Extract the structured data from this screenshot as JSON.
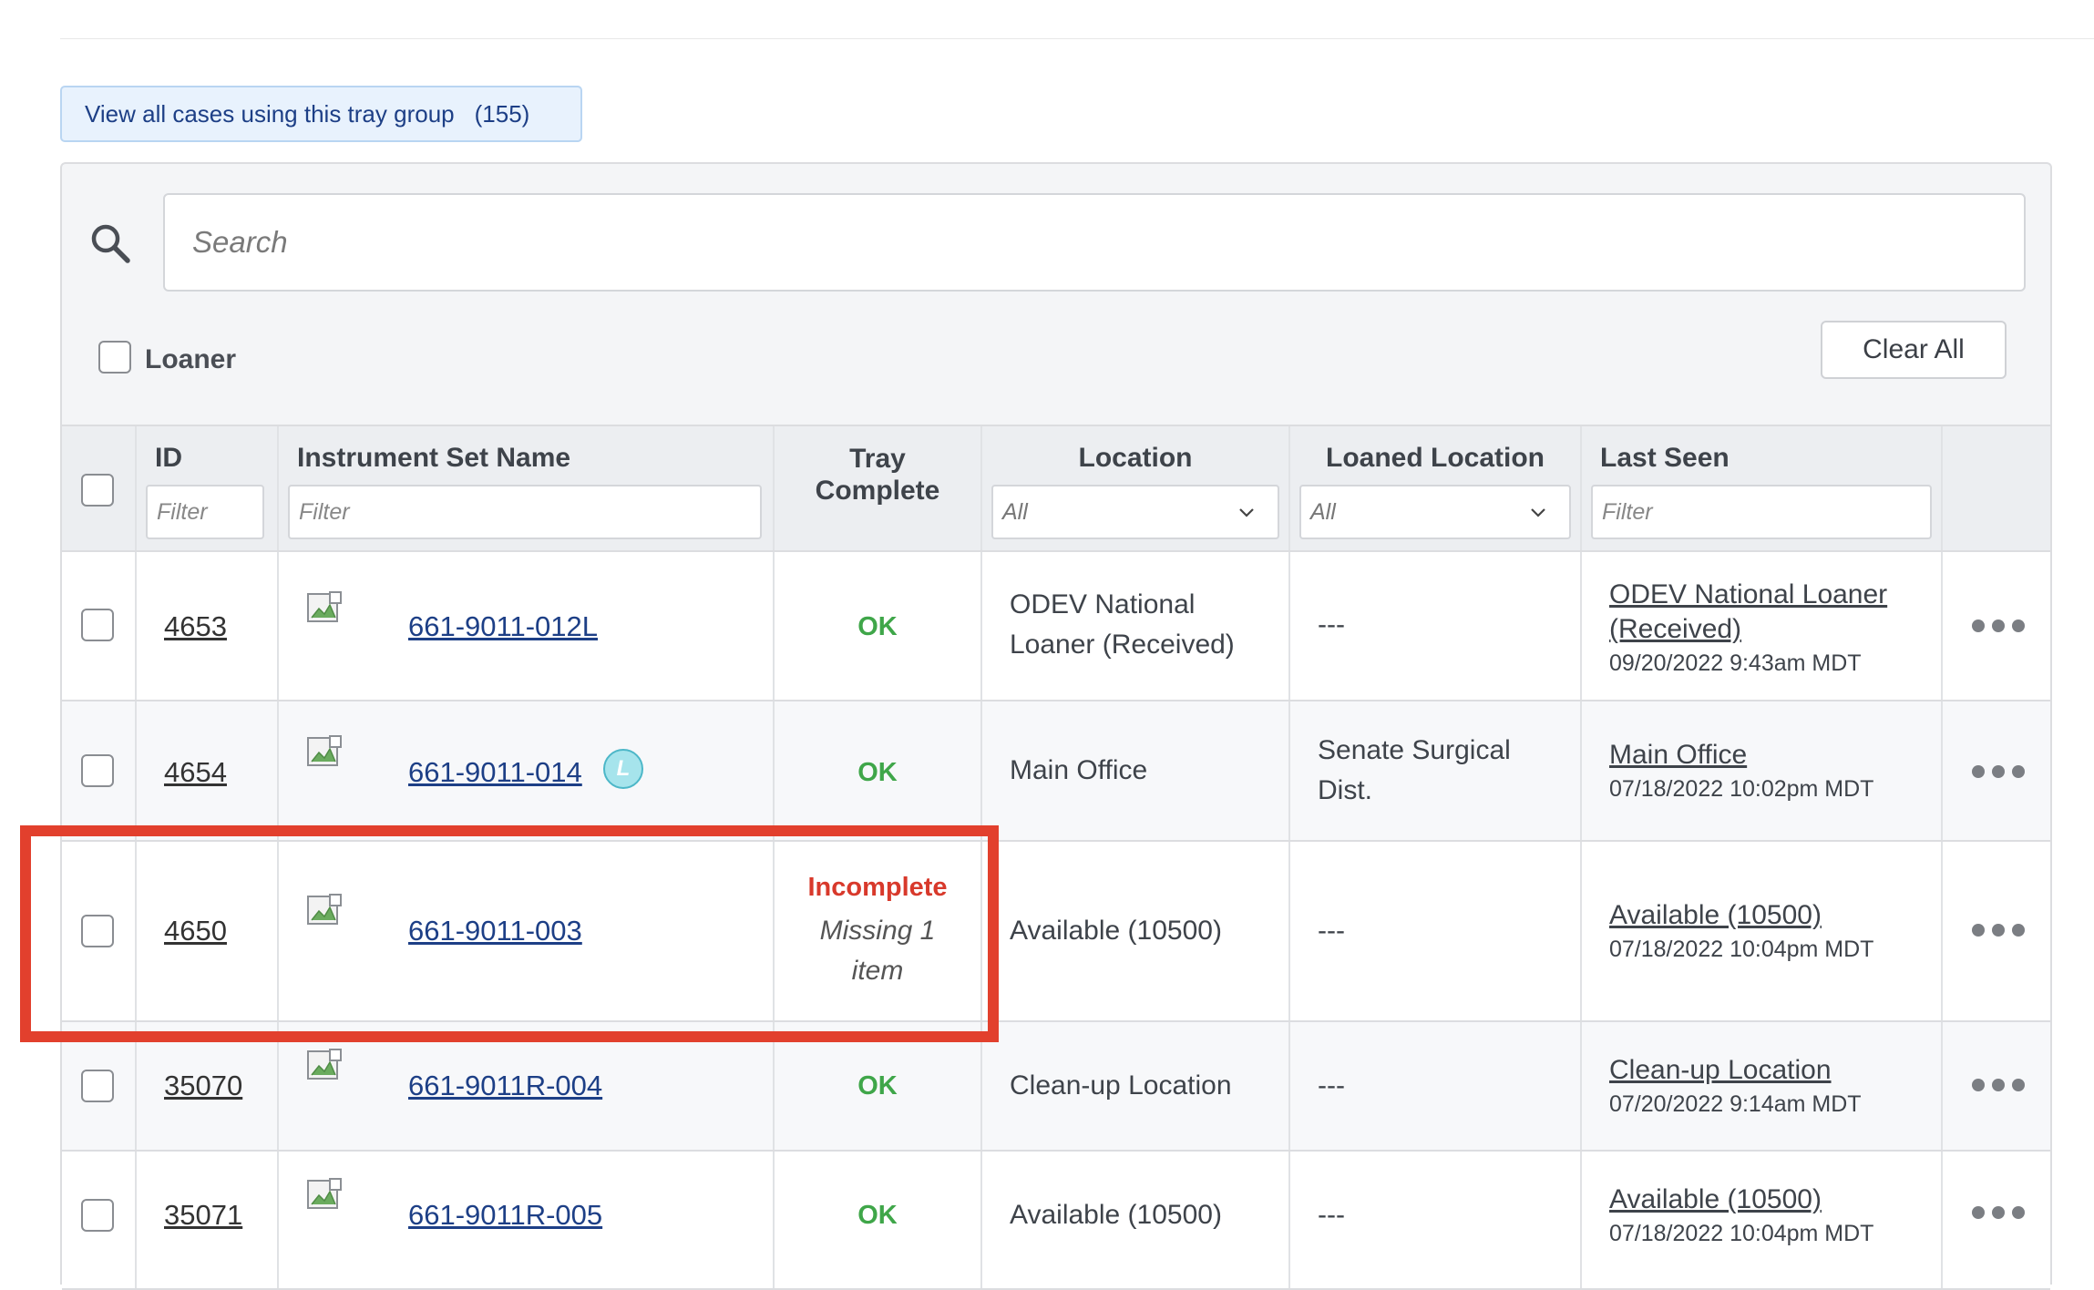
{
  "view_all": {
    "label": "View all cases using this tray group",
    "count": "(155)"
  },
  "search": {
    "placeholder": "Search"
  },
  "loaner_filter": {
    "label": "Loaner"
  },
  "clear_all": {
    "label": "Clear All"
  },
  "columns": {
    "id": "ID",
    "name": "Instrument Set Name",
    "tray_line1": "Tray",
    "tray_line2": "Complete",
    "location": "Location",
    "loaned": "Loaned Location",
    "seen": "Last Seen"
  },
  "filters": {
    "id_placeholder": "Filter",
    "name_placeholder": "Filter",
    "location_value": "All",
    "loaned_value": "All",
    "seen_placeholder": "Filter"
  },
  "rows": [
    {
      "id": "4653",
      "name": "661-9011-012L",
      "tray": "OK",
      "location": [
        "ODEV National",
        "Loaner (Received)"
      ],
      "loaned": [
        "---"
      ],
      "seen_location": [
        "ODEV National Loaner",
        "(Received)"
      ],
      "seen_time": "09/20/2022 9:43am MDT"
    },
    {
      "id": "4654",
      "name": "661-9011-014",
      "badge": "L",
      "tray": "OK",
      "location": [
        "Main Office"
      ],
      "loaned": [
        "Senate Surgical",
        "Dist."
      ],
      "seen_location": [
        "Main Office"
      ],
      "seen_time": "07/18/2022 10:02pm MDT"
    },
    {
      "id": "4650",
      "name": "661-9011-003",
      "tray": "Incomplete",
      "tray_note": [
        "Missing 1",
        "item"
      ],
      "location": [
        "Available (10500)"
      ],
      "loaned": [
        "---"
      ],
      "seen_location": [
        "Available (10500)"
      ],
      "seen_time": "07/18/2022 10:04pm MDT"
    },
    {
      "id": "35070",
      "name": "661-9011R-004",
      "tray": "OK",
      "location": [
        "Clean-up Location"
      ],
      "loaned": [
        "---"
      ],
      "seen_location": [
        "Clean-up Location"
      ],
      "seen_time": "07/20/2022 9:14am MDT"
    },
    {
      "id": "35071",
      "name": "661-9011R-005",
      "tray": "OK",
      "location": [
        "Available (10500)"
      ],
      "loaned": [
        "---"
      ],
      "seen_location": [
        "Available (10500)"
      ],
      "seen_time": "07/18/2022 10:04pm MDT"
    }
  ],
  "colors": {
    "link": "#1d3f86",
    "ok": "#3fa649",
    "incomplete": "#d8392b",
    "highlight": "#e2402d",
    "badge": "#a6e4ec"
  },
  "icons": {
    "search": "search-icon",
    "chevron": "chevron-down-icon",
    "thumbnail": "broken-image-icon",
    "actions": "more-horizontal-icon"
  }
}
